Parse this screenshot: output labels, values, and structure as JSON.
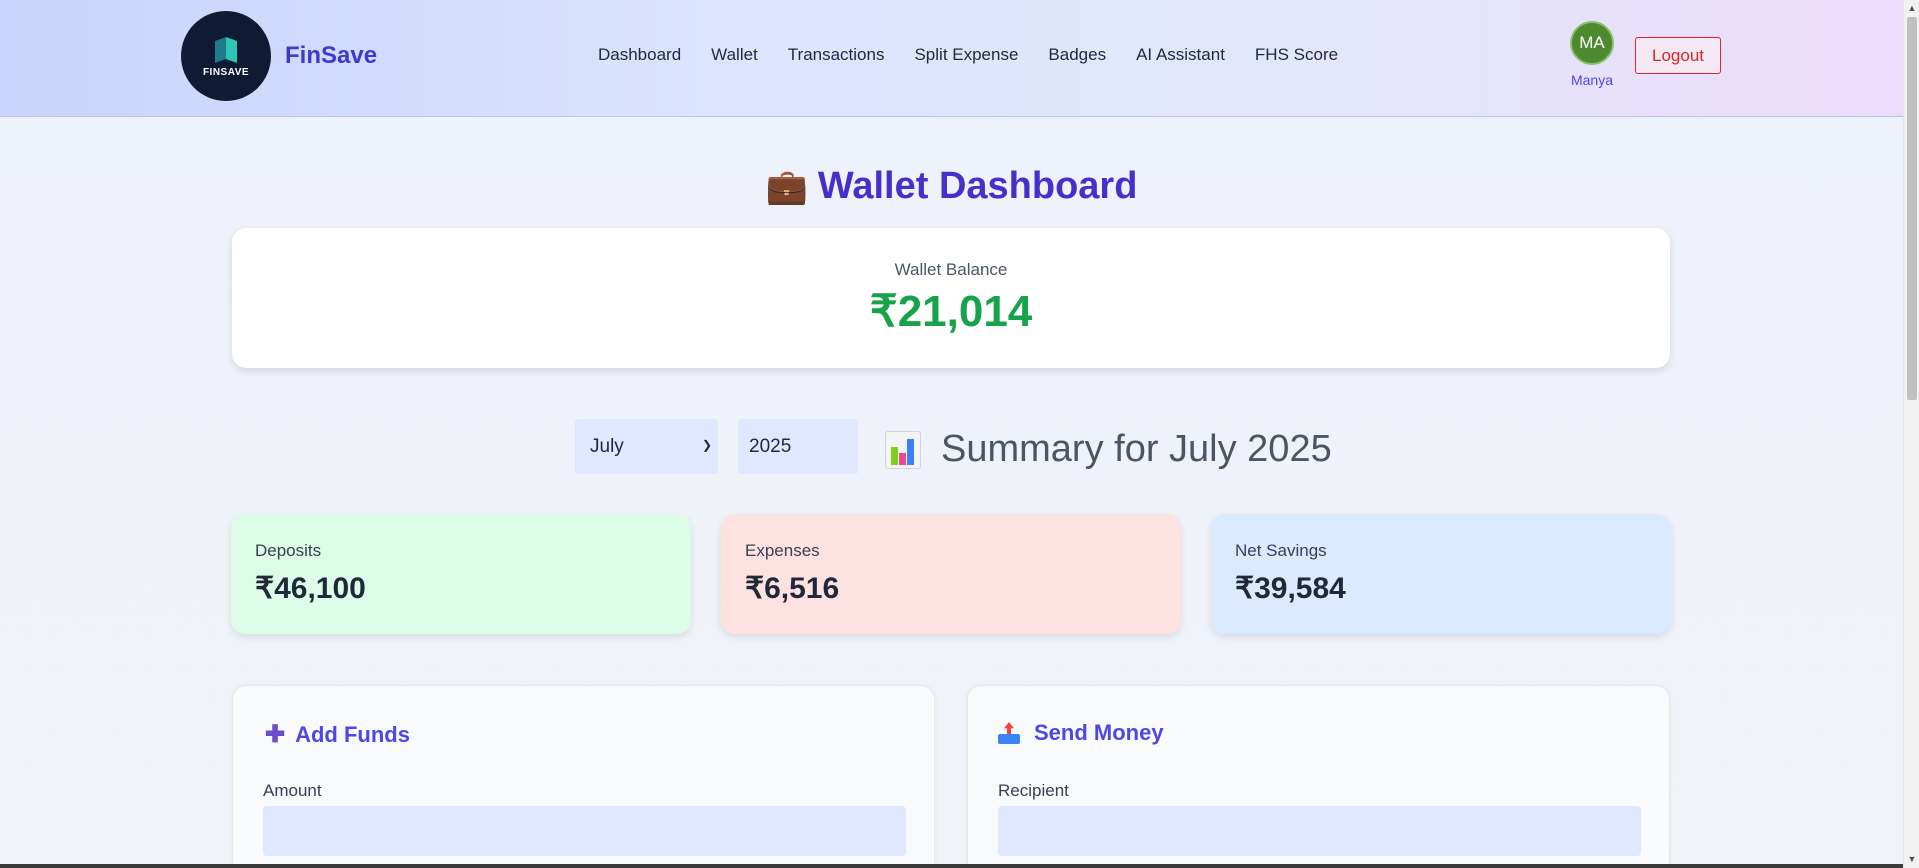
{
  "header": {
    "logo_text": "FINSAVE",
    "brand": "FinSave",
    "nav": [
      "Dashboard",
      "Wallet",
      "Transactions",
      "Split Expense",
      "Badges",
      "AI Assistant",
      "FHS Score"
    ],
    "avatar_initials": "MA",
    "user_name": "Manya",
    "logout_label": "Logout"
  },
  "page": {
    "title_icon": "💼",
    "title": "Wallet Dashboard"
  },
  "balance": {
    "label": "Wallet Balance",
    "value": "₹21,014"
  },
  "summary": {
    "month": "July",
    "year": "2025",
    "title": "Summary for July 2025",
    "icon": "bar-chart-icon"
  },
  "stats": [
    {
      "label": "Deposits",
      "value": "₹46,100"
    },
    {
      "label": "Expenses",
      "value": "₹6,516"
    },
    {
      "label": "Net Savings",
      "value": "₹39,584"
    }
  ],
  "panels": {
    "add_funds": {
      "icon": "plus-icon",
      "title": "Add Funds",
      "field_label": "Amount",
      "field_value": ""
    },
    "send_money": {
      "icon": "outbox-tray-icon",
      "title": "Send Money",
      "field_label": "Recipient",
      "field_value": ""
    }
  },
  "colors": {
    "brand": "#4338ca",
    "balance": "#16a34a",
    "logout": "#dc2626",
    "deposits_bg": "#dcfce7",
    "expenses_bg": "#fee2e2",
    "savings_bg": "#dbeafe"
  }
}
